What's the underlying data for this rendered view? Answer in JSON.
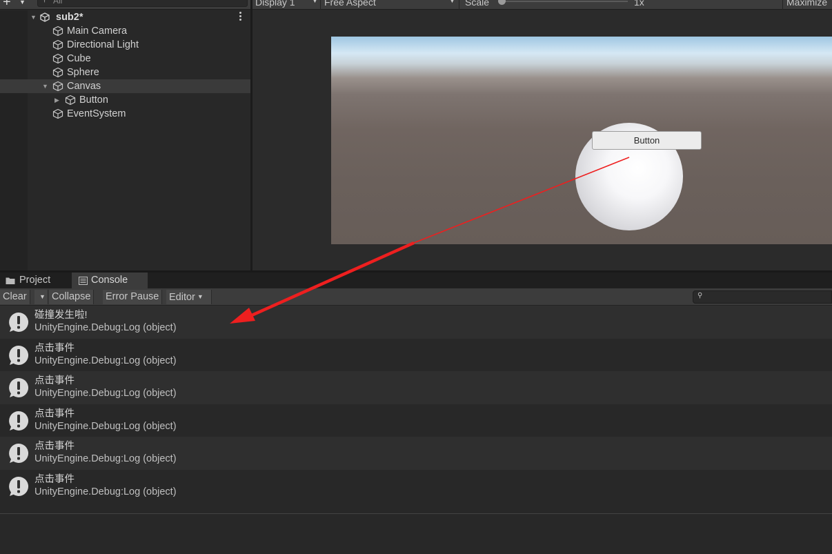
{
  "hierarchy": {
    "add_icon": "plus-icon",
    "search_placeholder": "All",
    "items": [
      {
        "label": "sub2*",
        "kind": "scene",
        "expanded": true
      },
      {
        "label": "Main Camera"
      },
      {
        "label": "Directional Light"
      },
      {
        "label": "Cube"
      },
      {
        "label": "Sphere"
      },
      {
        "label": "Canvas",
        "expanded": true,
        "selected": true
      },
      {
        "label": "Button",
        "collapsed": true
      },
      {
        "label": "EventSystem"
      }
    ]
  },
  "game_view": {
    "display": "Display 1",
    "aspect": "Free Aspect",
    "scale_label": "Scale",
    "scale_value": "1x",
    "maximize": "Maximize",
    "ui_button_label": "Button",
    "colors": {
      "sky": "#d5e8f4",
      "ground": "#6a605b",
      "sphere": "#f5f5f7"
    }
  },
  "tabs": [
    {
      "label": "Project",
      "icon": "folder-icon",
      "active": false
    },
    {
      "label": "Console",
      "icon": "console-list-icon",
      "active": true
    }
  ],
  "console_toolbar": {
    "clear": "Clear",
    "collapse": "Collapse",
    "error_pause": "Error Pause",
    "editor": "Editor"
  },
  "logs": [
    {
      "message": "碰撞发生啦!",
      "trace": "UnityEngine.Debug:Log (object)"
    },
    {
      "message": "点击事件",
      "trace": "UnityEngine.Debug:Log (object)"
    },
    {
      "message": "点击事件",
      "trace": "UnityEngine.Debug:Log (object)"
    },
    {
      "message": "点击事件",
      "trace": "UnityEngine.Debug:Log (object)"
    },
    {
      "message": "点击事件",
      "trace": "UnityEngine.Debug:Log (object)"
    },
    {
      "message": "点击事件",
      "trace": "UnityEngine.Debug:Log (object)"
    }
  ],
  "annotation": {
    "color": "#ee1f1f"
  }
}
